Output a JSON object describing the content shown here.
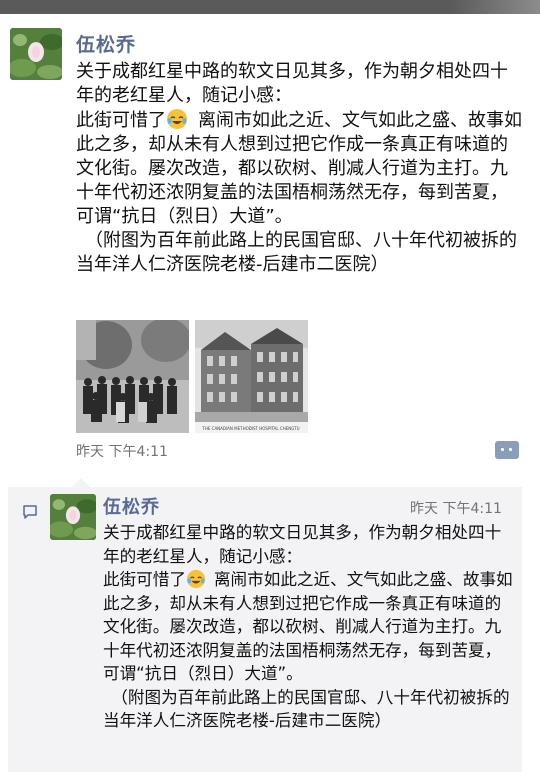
{
  "post": {
    "author": "伍松乔",
    "lines": [
      "关于成都红星中路的软文日见其多，作为朝夕相处四十年的老红星人，随记小感：",
      "此街可惜了",
      "离闹市如此之近、文气如此之盛、故事如此之多，却从未有人想到过把它作成一条真正有味道的文化街。屡次改造，都以砍树、削减人行道为主打。九十年代初还浓阴复盖的法国梧桐荡然无存，每到苦夏，可谓“抗日（烈日）大道”。",
      "（附图为百年前此路上的民国官邸、八十年代初被拆的当年洋人仁济医院老楼-后建市二医院）"
    ],
    "emoji": "grinning-tears-emoji",
    "photos": [
      {
        "name": "group-portrait-photo"
      },
      {
        "name": "hospital-building-photo",
        "caption": "THE CANADIAN METHODIST HOSPITAL CHENGTU"
      }
    ],
    "time": "昨天 下午4:11",
    "comment_button_icon": "comment-dots-icon"
  },
  "comment": {
    "icon": "comment-bubble-icon",
    "author": "伍松乔",
    "time": "昨天 下午4:11",
    "lines": [
      "关于成都红星中路的软文日见其多，作为朝夕相处四十年的老红星人，随记小感：",
      "此街可惜了",
      "离闹市如此之近、文气如此之盛、故事如此之多，却从未有人想到过把它作成一条真正有味道的文化街。屡次改造，都以砍树、削减人行道为主打。九十年代初还浓阴复盖的法国梧桐荡然无存，每到苦夏，可谓“抗日（烈日）大道”。",
      "（附图为百年前此路上的民国官邸、八十年代初被拆的当年洋人仁济医院老楼-后建市二医院）"
    ]
  },
  "colors": {
    "author": "#576b95",
    "timestamp": "#737373",
    "comment_bg": "#f3f3f5"
  }
}
